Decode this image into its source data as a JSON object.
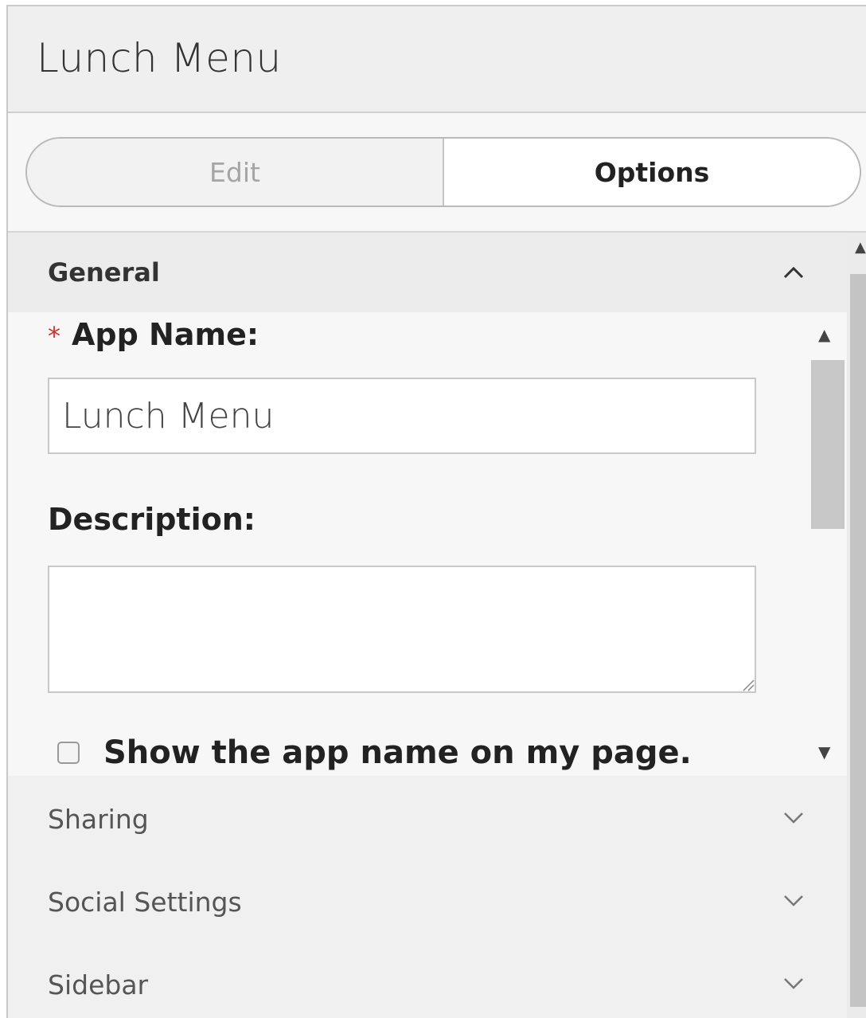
{
  "header": {
    "title": "Lunch Menu"
  },
  "tabs": [
    {
      "label": "Edit",
      "active": false
    },
    {
      "label": "Options",
      "active": true
    }
  ],
  "sections": {
    "general": {
      "label": "General",
      "expanded": true,
      "chevron_icon": "chevron-up-icon",
      "fields": {
        "app_name": {
          "required_mark": "*",
          "label": "App Name:",
          "value": "Lunch Menu"
        },
        "description": {
          "label": "Description:",
          "value": ""
        },
        "show_name": {
          "label": "Show the app name on my page.",
          "checked": false
        }
      }
    },
    "sharing": {
      "label": "Sharing",
      "expanded": false,
      "chevron_icon": "chevron-down-icon"
    },
    "social_settings": {
      "label": "Social Settings",
      "expanded": false,
      "chevron_icon": "chevron-down-icon"
    },
    "sidebar": {
      "label": "Sidebar",
      "expanded": false,
      "chevron_icon": "chevron-down-icon"
    }
  },
  "colors": {
    "required": "#d0342c",
    "panel_bg": "#f0f0f0",
    "active_tab_bg": "#ffffff",
    "inactive_tab_text": "#a5a5a5"
  }
}
